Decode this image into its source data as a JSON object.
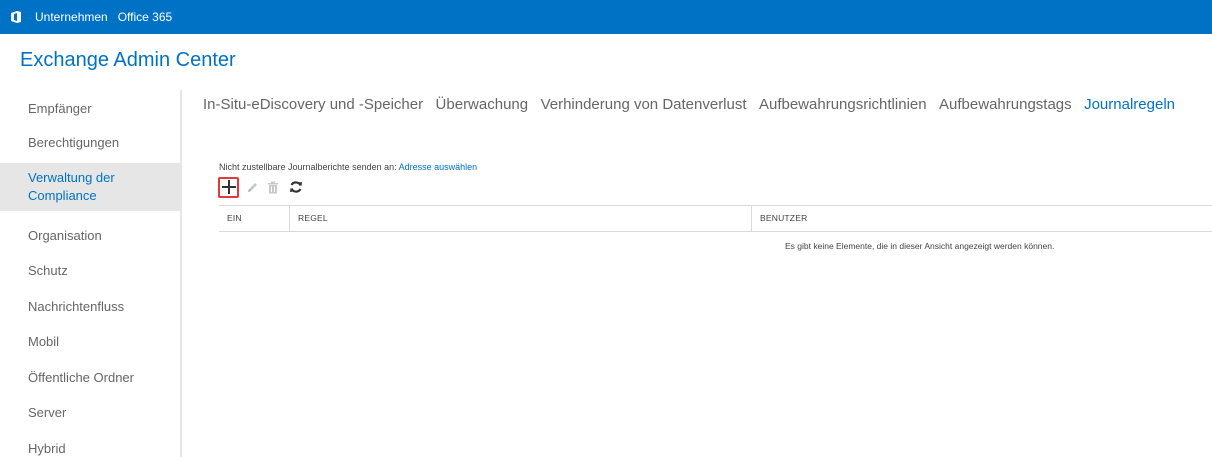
{
  "topbar": {
    "company_label": "Unternehmen",
    "office_label": "Office 365"
  },
  "app": {
    "title": "Exchange Admin Center"
  },
  "sidebar": {
    "items": [
      {
        "label": "Empfänger"
      },
      {
        "label": "Berechtigungen"
      },
      {
        "label": "Verwaltung der Compliance",
        "line1": "Verwaltung der",
        "line2": "Compliance",
        "active": true
      },
      {
        "label": "Organisation"
      },
      {
        "label": "Schutz"
      },
      {
        "label": "Nachrichtenfluss"
      },
      {
        "label": "Mobil"
      },
      {
        "label": "Öffentliche Ordner"
      },
      {
        "label": "Server"
      },
      {
        "label": "Hybrid"
      }
    ]
  },
  "tabs": [
    {
      "label": "In-Situ-eDiscovery und -Speicher"
    },
    {
      "label": "Überwachung"
    },
    {
      "label": "Verhinderung von Datenverlust"
    },
    {
      "label": "Aufbewahrungsrichtlinien"
    },
    {
      "label": "Aufbewahrungstags"
    },
    {
      "label": "Journalregeln",
      "active": true
    }
  ],
  "journal": {
    "info_text": "Nicht zustellbare Journalberichte senden an:",
    "link_text": "Adresse auswählen"
  },
  "toolbar": {
    "icons": [
      "add-icon",
      "edit-icon",
      "delete-icon",
      "refresh-icon"
    ]
  },
  "table": {
    "columns": [
      "EIN",
      "REGEL",
      "BENUTZER"
    ],
    "empty_message": "Es gibt keine Elemente, die in dieser Ansicht angezeigt werden können."
  },
  "colors": {
    "accent": "#0072c6",
    "highlight_border": "#e03a3a",
    "sidebar_active_bg": "#e6e6e6"
  }
}
